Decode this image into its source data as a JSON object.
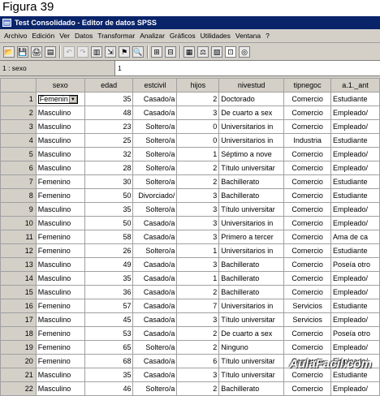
{
  "caption": "Figura 39",
  "window": {
    "title": "Test Consolidado - Editor de datos SPSS"
  },
  "menu": [
    "Archivo",
    "Edición",
    "Ver",
    "Datos",
    "Transformar",
    "Analizar",
    "Gráficos",
    "Utilidades",
    "Ventana",
    "?"
  ],
  "toolbar": [
    {
      "name": "open-icon",
      "glyph": "📂"
    },
    {
      "name": "save-icon",
      "glyph": "💾"
    },
    {
      "name": "print-icon",
      "glyph": "🖨"
    },
    {
      "name": "dialog-recall-icon",
      "glyph": "▤"
    },
    {
      "sep": true
    },
    {
      "name": "undo-icon",
      "glyph": "↶",
      "disabled": true
    },
    {
      "name": "redo-icon",
      "glyph": "↷",
      "disabled": true
    },
    {
      "name": "goto-chart-icon",
      "glyph": "▥"
    },
    {
      "name": "goto-case-icon",
      "glyph": "⇲"
    },
    {
      "name": "variables-icon",
      "glyph": "⚑"
    },
    {
      "name": "find-icon",
      "glyph": "🔍"
    },
    {
      "sep": true
    },
    {
      "name": "insert-case-icon",
      "glyph": "⊞"
    },
    {
      "name": "insert-variable-icon",
      "glyph": "⊟"
    },
    {
      "sep": true
    },
    {
      "name": "split-file-icon",
      "glyph": "▦"
    },
    {
      "name": "weight-cases-icon",
      "glyph": "⚖"
    },
    {
      "name": "select-cases-icon",
      "glyph": "▧"
    },
    {
      "name": "value-labels-icon",
      "glyph": "⊡",
      "active": true
    },
    {
      "name": "use-sets-icon",
      "glyph": "◎"
    }
  ],
  "cellbar": {
    "ref": "1 : sexo",
    "value": "1"
  },
  "columns": [
    "sexo",
    "edad",
    "estcivil",
    "hijos",
    "nivestud",
    "tipnegoc",
    "a.1._ant"
  ],
  "rows": [
    {
      "n": "1",
      "c": [
        "Femenin",
        "35",
        "Casado/a",
        "2",
        "Doctorado",
        "Comercio",
        "Estudiante"
      ]
    },
    {
      "n": "2",
      "c": [
        "Masculino",
        "48",
        "Casado/a",
        "3",
        "De cuarto a sex",
        "Comercio",
        "Empleado/"
      ]
    },
    {
      "n": "3",
      "c": [
        "Masculino",
        "23",
        "Soltero/a",
        "0",
        "Universitarios in",
        "Comercio",
        "Empleado/"
      ]
    },
    {
      "n": "4",
      "c": [
        "Masculino",
        "25",
        "Soltero/a",
        "0",
        "Universitarios in",
        "Industria",
        "Estudiante"
      ]
    },
    {
      "n": "5",
      "c": [
        "Masculino",
        "32",
        "Soltero/a",
        "1",
        "Séptimo a nove",
        "Comercio",
        "Empleado/"
      ]
    },
    {
      "n": "6",
      "c": [
        "Masculino",
        "28",
        "Soltero/a",
        "2",
        "Título universitar",
        "Comercio",
        "Empleado/"
      ]
    },
    {
      "n": "7",
      "c": [
        "Femenino",
        "30",
        "Soltero/a",
        "2",
        "Bachillerato",
        "Comercio",
        "Estudiante"
      ]
    },
    {
      "n": "8",
      "c": [
        "Femenino",
        "50",
        "Divorciado/",
        "3",
        "Bachillerato",
        "Comercio",
        "Estudiante"
      ]
    },
    {
      "n": "9",
      "c": [
        "Masculino",
        "35",
        "Soltero/a",
        "3",
        "Título universitar",
        "Comercio",
        "Empleado/"
      ]
    },
    {
      "n": "10",
      "c": [
        "Masculino",
        "50",
        "Casado/a",
        "3",
        "Universitarios in",
        "Comercio",
        "Empleado/"
      ]
    },
    {
      "n": "11",
      "c": [
        "Femenino",
        "58",
        "Casado/a",
        "3",
        "Primero a tercer",
        "Comercio",
        "Ama de ca"
      ]
    },
    {
      "n": "12",
      "c": [
        "Femenino",
        "26",
        "Soltero/a",
        "1",
        "Universitarios in",
        "Comercio",
        "Estudiante"
      ]
    },
    {
      "n": "13",
      "c": [
        "Masculino",
        "49",
        "Casado/a",
        "3",
        "Bachillerato",
        "Comercio",
        "Poseía otro"
      ]
    },
    {
      "n": "14",
      "c": [
        "Masculino",
        "35",
        "Casado/a",
        "1",
        "Bachillerato",
        "Comercio",
        "Empleado/"
      ]
    },
    {
      "n": "15",
      "c": [
        "Masculino",
        "36",
        "Casado/a",
        "2",
        "Bachillerato",
        "Comercio",
        "Empleado/"
      ]
    },
    {
      "n": "16",
      "c": [
        "Femenino",
        "57",
        "Casado/a",
        "7",
        "Universitarios in",
        "Servicios",
        "Estudiante"
      ]
    },
    {
      "n": "17",
      "c": [
        "Masculino",
        "45",
        "Casado/a",
        "3",
        "Título universitar",
        "Servicios",
        "Empleado/"
      ]
    },
    {
      "n": "18",
      "c": [
        "Femenino",
        "53",
        "Casado/a",
        "2",
        "De cuarto a sex",
        "Comercio",
        "Poseía otro"
      ]
    },
    {
      "n": "19",
      "c": [
        "Femenino",
        "65",
        "Soltero/a",
        "2",
        "Ninguno",
        "Comercio",
        "Empleado/"
      ]
    },
    {
      "n": "20",
      "c": [
        "Femenino",
        "68",
        "Casado/a",
        "6",
        "Título universitar",
        "Comercio",
        "Empleado/"
      ]
    },
    {
      "n": "21",
      "c": [
        "Masculino",
        "35",
        "Casado/a",
        "3",
        "Título universitar",
        "Comercio",
        "Estudiante"
      ]
    },
    {
      "n": "22",
      "c": [
        "Masculino",
        "46",
        "Soltero/a",
        "2",
        "Bachillerato",
        "Comercio",
        "Empleado/"
      ]
    }
  ],
  "watermark": "AulaFacil.com"
}
